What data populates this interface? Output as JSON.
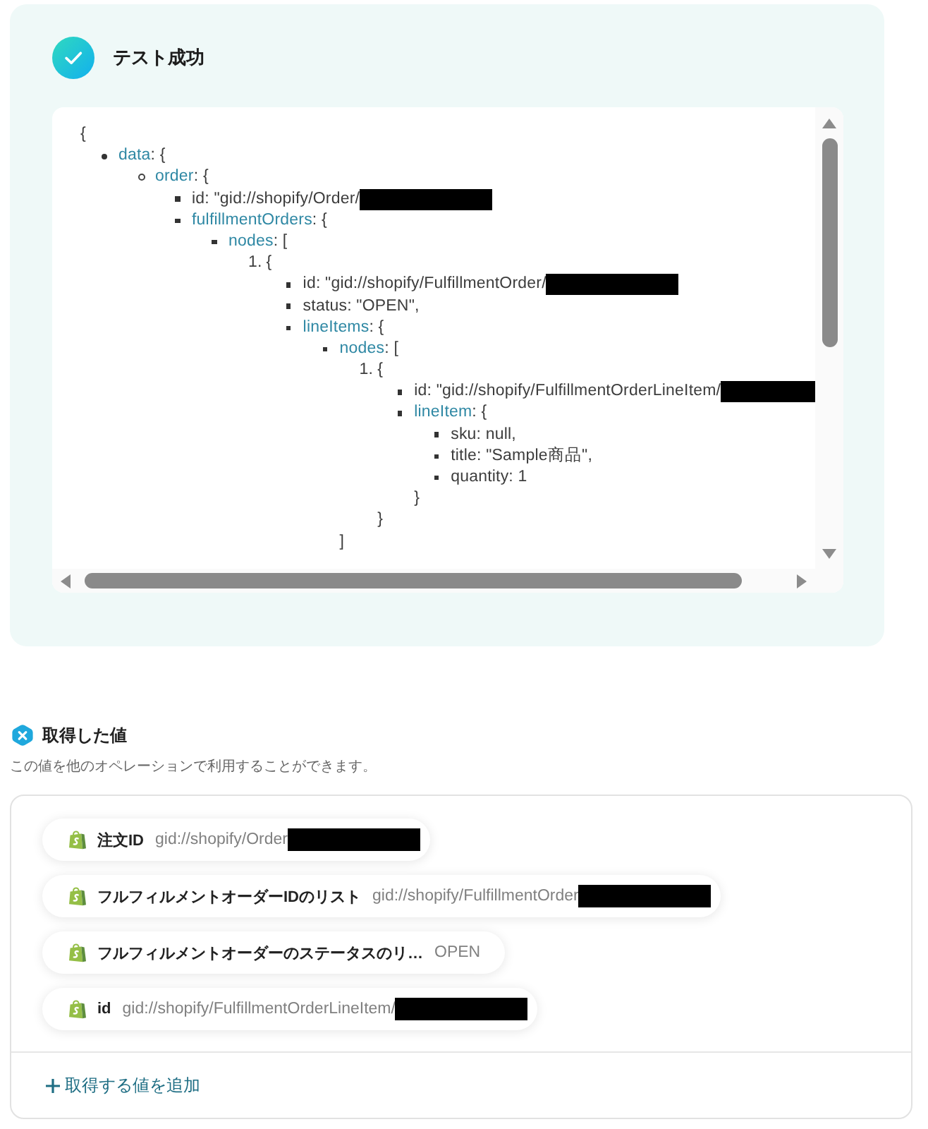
{
  "status_panel": {
    "title": "テスト成功"
  },
  "code_view": {
    "open": "{",
    "children": [
      {
        "kind": "disc",
        "key": "data",
        "text": ": {",
        "redacted": false,
        "children": [
          {
            "kind": "circle",
            "key": "order",
            "text": ": {",
            "redacted": false,
            "children": [
              {
                "kind": "square",
                "text": "id: \"gid://shopify/Order/",
                "redacted": true
              },
              {
                "kind": "square",
                "key": "fulfillmentOrders",
                "text": ": {",
                "redacted": false,
                "children": [
                  {
                    "kind": "square",
                    "key": "nodes",
                    "text": ": [",
                    "redacted": false,
                    "children": [
                      {
                        "kind": "number",
                        "number": "1.",
                        "text": "{",
                        "redacted": false,
                        "children": [
                          {
                            "kind": "square",
                            "text": "id: \"gid://shopify/FulfillmentOrder/",
                            "redacted": true
                          },
                          {
                            "kind": "square",
                            "text": "status: \"OPEN\",",
                            "redacted": false
                          },
                          {
                            "kind": "square",
                            "key": "lineItems",
                            "text": ": {",
                            "redacted": false,
                            "children": [
                              {
                                "kind": "square",
                                "key": "nodes",
                                "text": ": [",
                                "redacted": false,
                                "children": [
                                  {
                                    "kind": "number",
                                    "number": "1.",
                                    "text": "{",
                                    "redacted": false,
                                    "children": [
                                      {
                                        "kind": "square",
                                        "text": "id: \"gid://shopify/FulfillmentOrderLineItem/",
                                        "redacted": true
                                      },
                                      {
                                        "kind": "square",
                                        "key": "lineItem",
                                        "text": ": {",
                                        "redacted": false,
                                        "children": [
                                          {
                                            "kind": "square",
                                            "text": "sku: null,",
                                            "redacted": false
                                          },
                                          {
                                            "kind": "square",
                                            "text": "title: \"Sample商品\",",
                                            "redacted": false
                                          },
                                          {
                                            "kind": "square",
                                            "text": "quantity: 1",
                                            "redacted": false
                                          }
                                        ],
                                        "close": "}"
                                      }
                                    ],
                                    "close": "}"
                                  }
                                ],
                                "close": "]"
                              }
                            ]
                          }
                        ]
                      }
                    ]
                  }
                ]
              }
            ]
          }
        ]
      }
    ]
  },
  "fetched_values": {
    "title": "取得した値",
    "description": "この値を他のオペレーションで利用することができます。",
    "items": [
      {
        "label": "注文ID",
        "value": "gid://shopify/Order",
        "redacted": true
      },
      {
        "label": "フルフィルメントオーダーIDのリスト",
        "value": "gid://shopify/FulfillmentOrder",
        "redacted": true
      },
      {
        "label": "フルフィルメントオーダーのステータスのリ…",
        "value": "OPEN",
        "redacted": false
      },
      {
        "label": "id",
        "value": "gid://shopify/FulfillmentOrderLineItem/",
        "redacted": true
      }
    ],
    "add_button": "取得する値を追加"
  }
}
